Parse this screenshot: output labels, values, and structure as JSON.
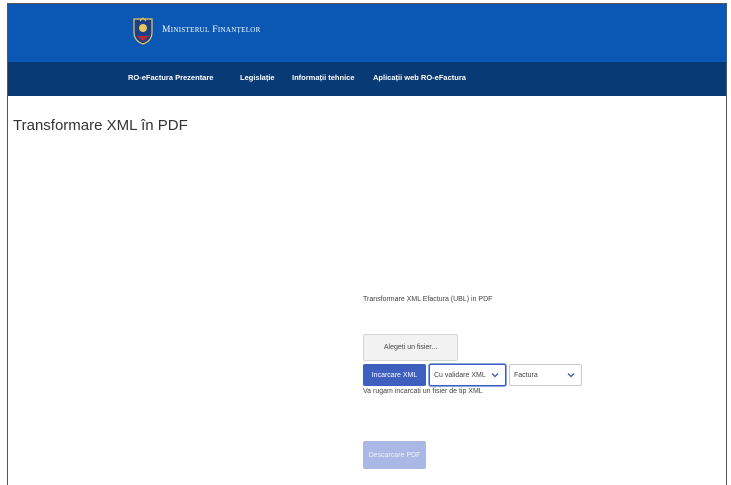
{
  "header": {
    "brand": "Ministerul Finanțelor",
    "logo_icon": "ministry-coat-of-arms-icon",
    "colors": {
      "topbar": "#0b58b4",
      "navbar": "#083a76"
    }
  },
  "nav": {
    "items": [
      {
        "label": "RO-eFactura Prezentare"
      },
      {
        "label": "Legislație"
      },
      {
        "label": "Informații tehnice"
      },
      {
        "label": "Aplicații web RO-eFactura"
      }
    ]
  },
  "main": {
    "title": "Transformare XML în PDF",
    "description": "Transformare XML Efactura (UBL) in PDF",
    "file_button_label": "Alegeti un fisier...",
    "upload_button_label": "Incarcare XML",
    "validation_select": {
      "value": "Cu validare XML",
      "icon": "chevron-down-icon"
    },
    "type_select": {
      "value": "Factura",
      "icon": "chevron-down-icon"
    },
    "hint": "Va rugam incarcati un fisier de tip XML",
    "download_button_label": "Descarcare PDF",
    "accent_color": "#3f5fbf"
  }
}
